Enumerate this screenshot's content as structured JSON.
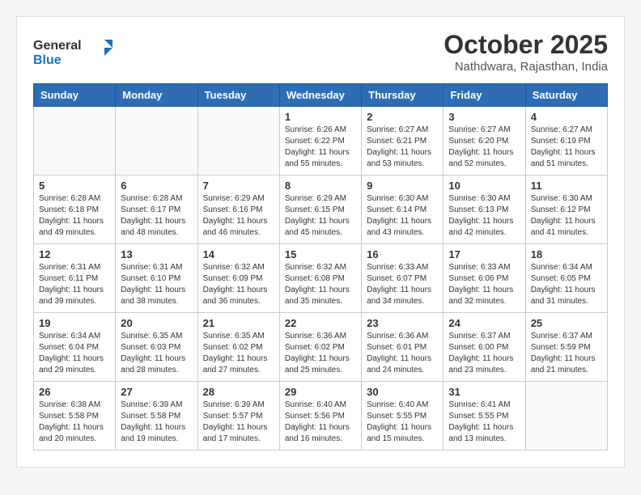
{
  "header": {
    "logo_general": "General",
    "logo_blue": "Blue",
    "month_title": "October 2025",
    "subtitle": "Nathdwara, Rajasthan, India"
  },
  "days_of_week": [
    "Sunday",
    "Monday",
    "Tuesday",
    "Wednesday",
    "Thursday",
    "Friday",
    "Saturday"
  ],
  "weeks": [
    [
      {
        "day": "",
        "info": ""
      },
      {
        "day": "",
        "info": ""
      },
      {
        "day": "",
        "info": ""
      },
      {
        "day": "1",
        "info": "Sunrise: 6:26 AM\nSunset: 6:22 PM\nDaylight: 11 hours\nand 55 minutes."
      },
      {
        "day": "2",
        "info": "Sunrise: 6:27 AM\nSunset: 6:21 PM\nDaylight: 11 hours\nand 53 minutes."
      },
      {
        "day": "3",
        "info": "Sunrise: 6:27 AM\nSunset: 6:20 PM\nDaylight: 11 hours\nand 52 minutes."
      },
      {
        "day": "4",
        "info": "Sunrise: 6:27 AM\nSunset: 6:19 PM\nDaylight: 11 hours\nand 51 minutes."
      }
    ],
    [
      {
        "day": "5",
        "info": "Sunrise: 6:28 AM\nSunset: 6:18 PM\nDaylight: 11 hours\nand 49 minutes."
      },
      {
        "day": "6",
        "info": "Sunrise: 6:28 AM\nSunset: 6:17 PM\nDaylight: 11 hours\nand 48 minutes."
      },
      {
        "day": "7",
        "info": "Sunrise: 6:29 AM\nSunset: 6:16 PM\nDaylight: 11 hours\nand 46 minutes."
      },
      {
        "day": "8",
        "info": "Sunrise: 6:29 AM\nSunset: 6:15 PM\nDaylight: 11 hours\nand 45 minutes."
      },
      {
        "day": "9",
        "info": "Sunrise: 6:30 AM\nSunset: 6:14 PM\nDaylight: 11 hours\nand 43 minutes."
      },
      {
        "day": "10",
        "info": "Sunrise: 6:30 AM\nSunset: 6:13 PM\nDaylight: 11 hours\nand 42 minutes."
      },
      {
        "day": "11",
        "info": "Sunrise: 6:30 AM\nSunset: 6:12 PM\nDaylight: 11 hours\nand 41 minutes."
      }
    ],
    [
      {
        "day": "12",
        "info": "Sunrise: 6:31 AM\nSunset: 6:11 PM\nDaylight: 11 hours\nand 39 minutes."
      },
      {
        "day": "13",
        "info": "Sunrise: 6:31 AM\nSunset: 6:10 PM\nDaylight: 11 hours\nand 38 minutes."
      },
      {
        "day": "14",
        "info": "Sunrise: 6:32 AM\nSunset: 6:09 PM\nDaylight: 11 hours\nand 36 minutes."
      },
      {
        "day": "15",
        "info": "Sunrise: 6:32 AM\nSunset: 6:08 PM\nDaylight: 11 hours\nand 35 minutes."
      },
      {
        "day": "16",
        "info": "Sunrise: 6:33 AM\nSunset: 6:07 PM\nDaylight: 11 hours\nand 34 minutes."
      },
      {
        "day": "17",
        "info": "Sunrise: 6:33 AM\nSunset: 6:06 PM\nDaylight: 11 hours\nand 32 minutes."
      },
      {
        "day": "18",
        "info": "Sunrise: 6:34 AM\nSunset: 6:05 PM\nDaylight: 11 hours\nand 31 minutes."
      }
    ],
    [
      {
        "day": "19",
        "info": "Sunrise: 6:34 AM\nSunset: 6:04 PM\nDaylight: 11 hours\nand 29 minutes."
      },
      {
        "day": "20",
        "info": "Sunrise: 6:35 AM\nSunset: 6:03 PM\nDaylight: 11 hours\nand 28 minutes."
      },
      {
        "day": "21",
        "info": "Sunrise: 6:35 AM\nSunset: 6:02 PM\nDaylight: 11 hours\nand 27 minutes."
      },
      {
        "day": "22",
        "info": "Sunrise: 6:36 AM\nSunset: 6:02 PM\nDaylight: 11 hours\nand 25 minutes."
      },
      {
        "day": "23",
        "info": "Sunrise: 6:36 AM\nSunset: 6:01 PM\nDaylight: 11 hours\nand 24 minutes."
      },
      {
        "day": "24",
        "info": "Sunrise: 6:37 AM\nSunset: 6:00 PM\nDaylight: 11 hours\nand 23 minutes."
      },
      {
        "day": "25",
        "info": "Sunrise: 6:37 AM\nSunset: 5:59 PM\nDaylight: 11 hours\nand 21 minutes."
      }
    ],
    [
      {
        "day": "26",
        "info": "Sunrise: 6:38 AM\nSunset: 5:58 PM\nDaylight: 11 hours\nand 20 minutes."
      },
      {
        "day": "27",
        "info": "Sunrise: 6:39 AM\nSunset: 5:58 PM\nDaylight: 11 hours\nand 19 minutes."
      },
      {
        "day": "28",
        "info": "Sunrise: 6:39 AM\nSunset: 5:57 PM\nDaylight: 11 hours\nand 17 minutes."
      },
      {
        "day": "29",
        "info": "Sunrise: 6:40 AM\nSunset: 5:56 PM\nDaylight: 11 hours\nand 16 minutes."
      },
      {
        "day": "30",
        "info": "Sunrise: 6:40 AM\nSunset: 5:55 PM\nDaylight: 11 hours\nand 15 minutes."
      },
      {
        "day": "31",
        "info": "Sunrise: 6:41 AM\nSunset: 5:55 PM\nDaylight: 11 hours\nand 13 minutes."
      },
      {
        "day": "",
        "info": ""
      }
    ]
  ]
}
